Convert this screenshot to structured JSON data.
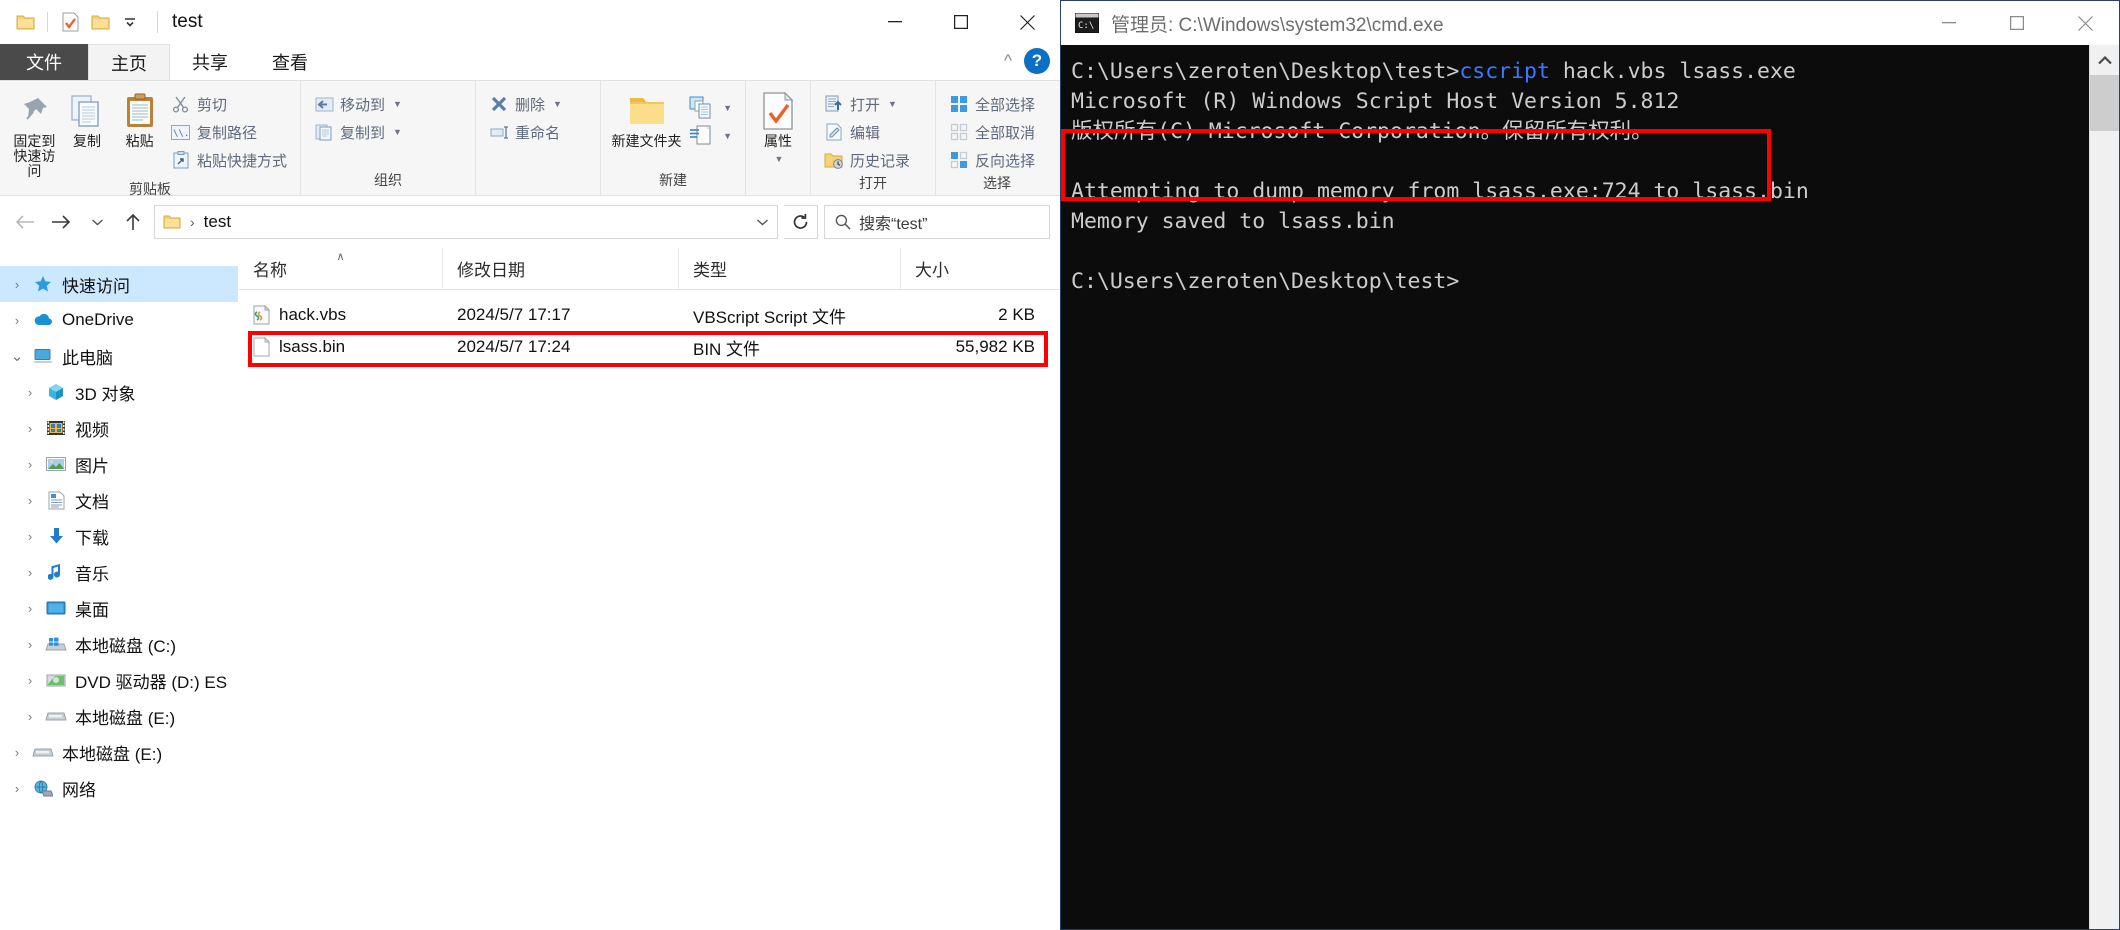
{
  "explorer": {
    "title": "test",
    "quick_access_icons": [
      "folder-icon",
      "properties-icon",
      "new-folder-icon",
      "customize-qat-caret-icon"
    ],
    "window_controls": {
      "minimize": "—",
      "maximize": "□",
      "close": "✕"
    },
    "tabs": [
      {
        "label": "文件",
        "name": "tab-file"
      },
      {
        "label": "主页",
        "name": "tab-home"
      },
      {
        "label": "共享",
        "name": "tab-share"
      },
      {
        "label": "查看",
        "name": "tab-view"
      }
    ],
    "help_label": "?",
    "ribbon": {
      "groups": [
        {
          "label": "剪贴板",
          "big": [
            {
              "label": "固定到快速访问",
              "icon": "pin-icon"
            },
            {
              "label": "复制",
              "icon": "copy-icon"
            },
            {
              "label": "粘贴",
              "icon": "paste-clipboard-icon"
            }
          ],
          "small": [
            {
              "label": "剪切",
              "icon": "scissors-icon"
            },
            {
              "label": "复制路径",
              "icon": "copy-path-icon"
            },
            {
              "label": "粘贴快捷方式",
              "icon": "paste-shortcut-icon"
            }
          ]
        },
        {
          "label": "组织",
          "small": [
            {
              "label": "移动到",
              "icon": "move-to-icon",
              "caret": true
            },
            {
              "label": "复制到",
              "icon": "copy-to-icon",
              "caret": true
            }
          ],
          "small2": [
            {
              "label": "删除",
              "icon": "delete-x-icon",
              "caret": true
            },
            {
              "label": "重命名",
              "icon": "rename-icon",
              "caret": false
            }
          ]
        },
        {
          "label": "新建",
          "big": [
            {
              "label": "新建文件夹",
              "icon": "new-folder-icon"
            }
          ],
          "small": [
            {
              "label": "",
              "icon": "new-item-icon",
              "caret": true
            },
            {
              "label": "",
              "icon": "easy-access-icon",
              "caret": true
            }
          ]
        },
        {
          "label": "打开",
          "big": [
            {
              "label": "属性",
              "icon": "properties-icon",
              "caret": true
            }
          ],
          "small": [
            {
              "label": "打开",
              "icon": "open-icon",
              "caret": true
            },
            {
              "label": "编辑",
              "icon": "edit-icon"
            },
            {
              "label": "历史记录",
              "icon": "history-icon"
            }
          ]
        },
        {
          "label": "选择",
          "small": [
            {
              "label": "全部选择",
              "icon": "select-all-icon"
            },
            {
              "label": "全部取消",
              "icon": "select-none-icon"
            },
            {
              "label": "反向选择",
              "icon": "invert-selection-icon"
            }
          ]
        }
      ]
    },
    "addressbar": {
      "back_icon": "arrow-left-icon",
      "forward_icon": "arrow-right-icon",
      "recent_icon": "chevron-down-icon",
      "up_icon": "arrow-up-icon",
      "crumb_icon": "folder-icon",
      "crumb_sep": "›",
      "path": "test",
      "dropdown_icon": "chevron-down-icon",
      "refresh_icon": "refresh-icon",
      "search_icon": "search-icon",
      "search_placeholder": "搜索“test”"
    },
    "navpane": [
      {
        "label": "快速访问",
        "icon": "star-icon",
        "level": 1,
        "expander": "›",
        "selected": true
      },
      {
        "label": "OneDrive",
        "icon": "onedrive-cloud-icon",
        "level": 1,
        "expander": "›",
        "selected": false
      },
      {
        "label": "此电脑",
        "icon": "this-pc-icon",
        "level": 1,
        "expander": "ⱟ",
        "selected": false
      },
      {
        "label": "3D 对象",
        "icon": "3d-objects-icon",
        "level": 2,
        "expander": "›",
        "selected": false
      },
      {
        "label": "视频",
        "icon": "videos-icon",
        "level": 2,
        "expander": "›",
        "selected": false
      },
      {
        "label": "图片",
        "icon": "pictures-icon",
        "level": 2,
        "expander": "›",
        "selected": false
      },
      {
        "label": "文档",
        "icon": "documents-icon",
        "level": 2,
        "expander": "›",
        "selected": false
      },
      {
        "label": "下载",
        "icon": "downloads-icon",
        "level": 2,
        "expander": "›",
        "selected": false
      },
      {
        "label": "音乐",
        "icon": "music-icon",
        "level": 2,
        "expander": "›",
        "selected": false
      },
      {
        "label": "桌面",
        "icon": "desktop-icon",
        "level": 2,
        "expander": "›",
        "selected": false
      },
      {
        "label": "本地磁盘 (C:)",
        "icon": "windows-drive-icon",
        "level": 2,
        "expander": "›",
        "selected": false
      },
      {
        "label": "DVD 驱动器 (D:) ES",
        "icon": "dvd-drive-icon",
        "level": 2,
        "expander": "›",
        "selected": false
      },
      {
        "label": "本地磁盘 (E:)",
        "icon": "drive-icon",
        "level": 2,
        "expander": "›",
        "selected": false
      },
      {
        "label": "本地磁盘 (E:)",
        "icon": "drive-icon",
        "level": 1,
        "expander": "›",
        "selected": false
      },
      {
        "label": "网络",
        "icon": "network-icon",
        "level": 1,
        "expander": "›",
        "selected": false
      }
    ],
    "filelist": {
      "columns": [
        {
          "label": "名称",
          "sorted": true,
          "sort_arrow": "∧"
        },
        {
          "label": "修改日期",
          "sorted": false
        },
        {
          "label": "类型",
          "sorted": false
        },
        {
          "label": "大小",
          "sorted": false
        }
      ],
      "rows": [
        {
          "name": "hack.vbs",
          "date": "2024/5/7 17:17",
          "type": "VBScript Script 文件",
          "size": "2 KB",
          "icon": "vbs-script-icon",
          "highlighted": false
        },
        {
          "name": "lsass.bin",
          "date": "2024/5/7 17:24",
          "type": "BIN 文件",
          "size": "55,982 KB",
          "icon": "generic-file-icon",
          "highlighted": true
        }
      ]
    }
  },
  "cmd": {
    "title": "管理员: C:\\Windows\\system32\\cmd.exe",
    "icon": "cmd-console-icon",
    "window_controls": {
      "minimize": "—",
      "maximize": "□",
      "close": "✕"
    },
    "console_lines": [
      {
        "prompt": "C:\\Users\\zeroten\\Desktop\\test>",
        "command": "cscript",
        "args": " hack.vbs lsass.exe"
      },
      {
        "text": "Microsoft (R) Windows Script Host Version 5.812"
      },
      {
        "text": "版权所有(C) Microsoft Corporation。保留所有权利。"
      },
      {
        "text": ""
      },
      {
        "text": "Attempting to dump memory from lsass.exe:724 to lsass.bin"
      },
      {
        "text": "Memory saved to lsass.bin"
      },
      {
        "text": ""
      },
      {
        "prompt": "C:\\Users\\zeroten\\Desktop\\test>",
        "command": "",
        "args": ""
      }
    ],
    "scrollbar": {
      "up_arrow": "ⱎ",
      "thumb": "scroll-thumb"
    }
  },
  "annotations": {
    "highlight_color": "#ff0000",
    "boxes": [
      {
        "name": "file-row-highlight-box",
        "target": "lsass.bin row"
      },
      {
        "name": "console-output-highlight-box",
        "target": "dump memory output lines"
      }
    ]
  }
}
